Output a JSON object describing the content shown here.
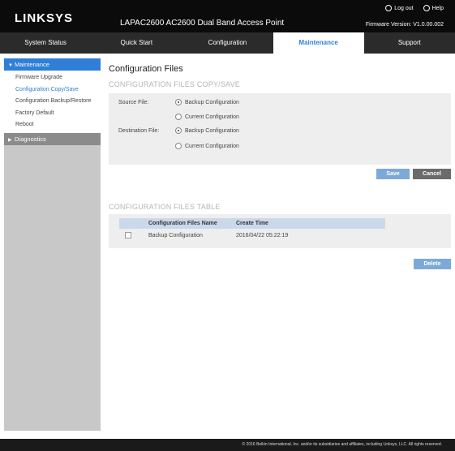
{
  "header": {
    "logo": "LINKSYS",
    "product_title": "LAPAC2600 AC2600 Dual Band Access Point",
    "logout_label": "Log out",
    "help_label": "Help",
    "firmware": "Firmware Version: V1.0.00.002"
  },
  "nav": {
    "tabs": [
      {
        "label": "System Status"
      },
      {
        "label": "Quick Start"
      },
      {
        "label": "Configuration"
      },
      {
        "label": "Maintenance"
      },
      {
        "label": "Support"
      }
    ]
  },
  "sidebar": {
    "maintenance_label": "Maintenance",
    "items": [
      {
        "label": "Firmware Upgrade"
      },
      {
        "label": "Configuration Copy/Save"
      },
      {
        "label": "Configuration Backup/Restore"
      },
      {
        "label": "Factory Default"
      },
      {
        "label": "Reboot"
      }
    ],
    "diagnostics_label": "Diagnostics"
  },
  "main": {
    "page_title": "Configuration Files",
    "copy_heading": "CONFIGURATION FILES COPY/SAVE",
    "source_label": "Source File:",
    "source_options": [
      "Backup Configuration",
      "Current Configuration"
    ],
    "destination_label": "Destination File:",
    "destination_options": [
      "Backup Configuration",
      "Current Configuration"
    ],
    "save_label": "Save",
    "cancel_label": "Cancel",
    "table_heading": "CONFIGURATION FILES TABLE",
    "table": {
      "columns": [
        "Configuration Files Name",
        "Create Time"
      ],
      "rows": [
        {
          "name": "Backup Configuration",
          "time": "2016/04/22 05:22:19"
        }
      ]
    },
    "delete_label": "Delete"
  },
  "footer": {
    "text": "© 2016 Belkin International, Inc. and/or its subsidiaries and affiliates, including Linksys, LLC. All rights reserved."
  },
  "colors": {
    "accent": "#2f7fd6",
    "header_bg": "#0b0b0b",
    "nav_bg": "#2b2b2b",
    "button_blue": "#7da9d8",
    "button_gray": "#6b6b6b"
  }
}
